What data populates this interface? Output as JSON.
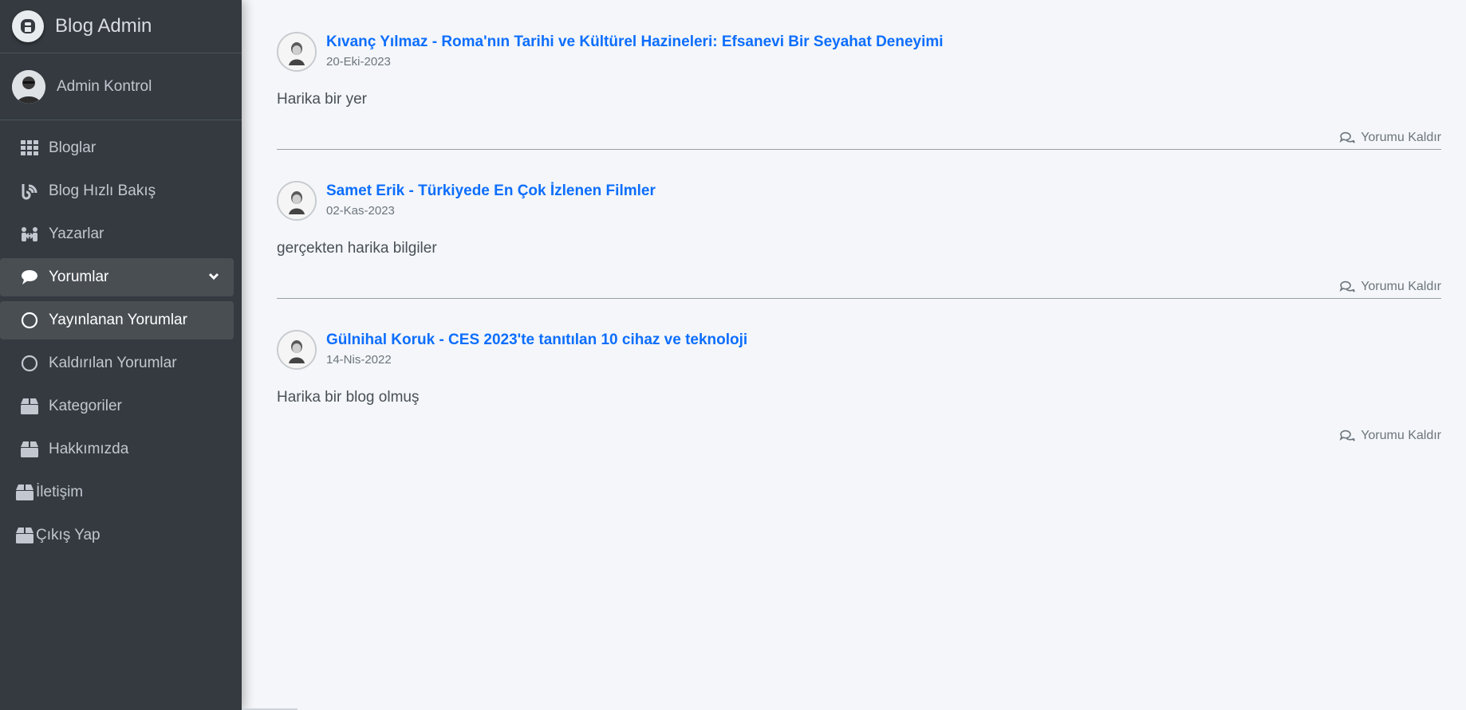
{
  "brand": {
    "title": "Blog Admin"
  },
  "user": {
    "name": "Admin Kontrol"
  },
  "nav": {
    "bloglar": "Bloglar",
    "quick_view": "Blog Hızlı Bakış",
    "authors": "Yazarlar",
    "comments": "Yorumlar",
    "published_comments": "Yayınlanan Yorumlar",
    "removed_comments": "Kaldırılan Yorumlar",
    "categories": "Kategoriler",
    "about": "Hakkımızda",
    "contact": "İletişim",
    "logout": "Çıkış Yap"
  },
  "comments": [
    {
      "title": "Kıvanç Yılmaz - Roma'nın Tarihi ve Kültürel Hazineleri: Efsanevi Bir Seyahat Deneyimi",
      "date": "20-Eki-2023",
      "body": "Harika bir yer",
      "action": "Yorumu Kaldır"
    },
    {
      "title": "Samet Erik - Türkiyede En Çok İzlenen Filmler",
      "date": "02-Kas-2023",
      "body": "gerçekten harika bilgiler",
      "action": "Yorumu Kaldır"
    },
    {
      "title": "Gülnihal Koruk - CES 2023'te tanıtılan 10 cihaz ve teknoloji",
      "date": "14-Nis-2022",
      "body": "Harika bir blog olmuş",
      "action": "Yorumu Kaldır"
    }
  ],
  "colors": {
    "sidebar_bg": "#343a40",
    "link": "#0d6efd",
    "content_bg": "#f4f6f9"
  }
}
